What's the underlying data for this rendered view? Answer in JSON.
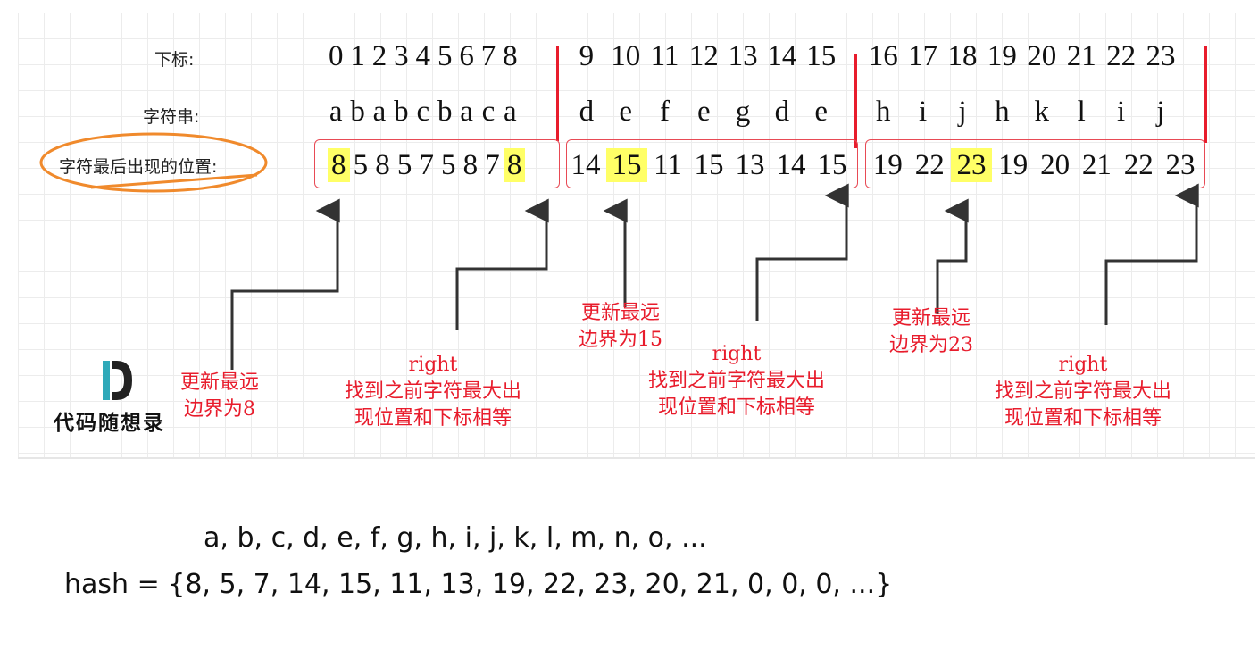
{
  "labels": {
    "index": "下标:",
    "string": "字符串:",
    "last_pos": "字符最后出现的位置:"
  },
  "indices": [
    "0",
    "1",
    "2",
    "3",
    "4",
    "5",
    "6",
    "7",
    "8",
    "9",
    "10",
    "11",
    "12",
    "13",
    "14",
    "15",
    "16",
    "17",
    "18",
    "19",
    "20",
    "21",
    "22",
    "23"
  ],
  "chars": [
    "a",
    "b",
    "a",
    "b",
    "c",
    "b",
    "a",
    "c",
    "a",
    "d",
    "e",
    "f",
    "e",
    "g",
    "d",
    "e",
    "h",
    "i",
    "j",
    "h",
    "k",
    "l",
    "i",
    "j"
  ],
  "last_positions": [
    "8",
    "5",
    "8",
    "5",
    "7",
    "5",
    "8",
    "7",
    "8",
    "14",
    "15",
    "11",
    "15",
    "13",
    "14",
    "15",
    "19",
    "22",
    "23",
    "19",
    "20",
    "21",
    "22",
    "23"
  ],
  "highlighted_cells": [
    0,
    8,
    10,
    18
  ],
  "annotations": {
    "update_8": [
      "更新最远",
      "边界为8"
    ],
    "right_1": [
      "right",
      "找到之前字符最大出",
      "现位置和下标相等"
    ],
    "update_15": [
      "更新最远",
      "边界为15"
    ],
    "right_2": [
      "right",
      "找到之前字符最大出",
      "现位置和下标相等"
    ],
    "update_23": [
      "更新最远",
      "边界为23"
    ],
    "right_3": [
      "right",
      "找到之前字符最大出",
      "现位置和下标相等"
    ]
  },
  "logo": {
    "letter": "D",
    "text": "代码随想录"
  },
  "hash_keys": "a,   b,  c,   d,    e,    f,    g,    h,    i,     j,    k,    l,   m,   n,   o, ...",
  "hash_values": "hash = {8,  5,  7,  14,  15,  11,  13,  19,  22,  23,  20,  21,  0,    0,   0, ...}",
  "colors": {
    "highlight": "#ffff66",
    "red": "#e81c2c",
    "ellipse": "#f08a2c",
    "logo_teal": "#2fa9b9"
  }
}
